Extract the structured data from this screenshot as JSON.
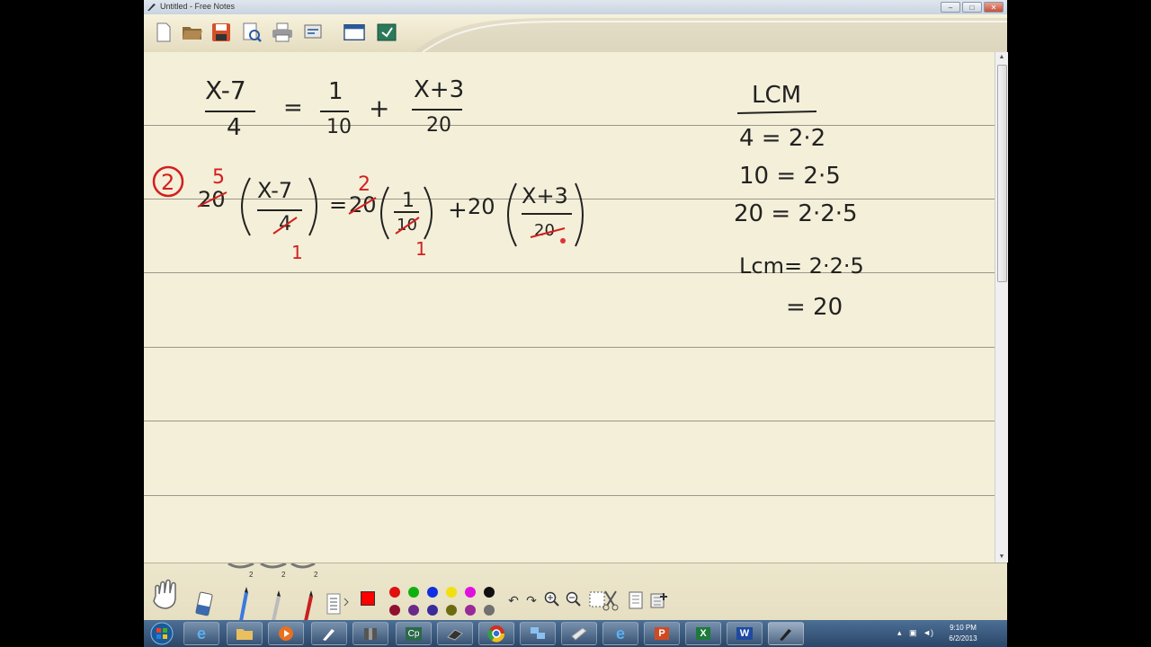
{
  "window": {
    "title": "Untitled - Free Notes"
  },
  "titlebar_buttons": {
    "minimize": "–",
    "maximize": "□",
    "close": "✕"
  },
  "toolbar": {
    "icons": [
      "new-file-icon",
      "open-folder-icon",
      "save-icon",
      "print-preview-icon",
      "print-icon",
      "settings-icon",
      "window-icon",
      "export-icon"
    ]
  },
  "notes": {
    "ink_color": "#222222",
    "correction_color": "#d21f1f",
    "equation": {
      "lhs_num": "X-7",
      "lhs_den": "4",
      "eq": "=",
      "t1_num": "1",
      "t1_den": "10",
      "plus": "+",
      "t2_num": "X+3",
      "t2_den": "20"
    },
    "step2": {
      "circle": "2",
      "mult1": "20",
      "r1": "5",
      "f1_num": "X-7",
      "f1_den": "4",
      "f1_red": "1",
      "eq": "=",
      "mult2": "20",
      "r2": "2",
      "f2_num": "1",
      "f2_den": "10",
      "f2_red": "1",
      "plus": "+",
      "mult3": "20",
      "f3_num": "X+3",
      "f3_den": "20"
    },
    "lcm": {
      "heading": "LCM",
      "lines": [
        "4 = 2·2",
        "10 = 2·5",
        "20 = 2·2·5"
      ],
      "result_label": "Lcm= 2·2·5",
      "result_value": "= 20"
    }
  },
  "bottombar": {
    "pen_widths": [
      "2",
      "2",
      "2"
    ],
    "colors": [
      "#e01010",
      "#10b010",
      "#1030e0",
      "#f0e010",
      "#e010e0",
      "#101010",
      "#901030",
      "#6a2a8a",
      "#3a2a9a",
      "#6b6b10",
      "#9a2a9a",
      "#707070"
    ],
    "selected_color": "#ff0000"
  },
  "taskbar": {
    "apps": [
      "start-orb",
      "ie-icon",
      "explorer-icon",
      "media-player-icon",
      "free-notes-icon",
      "archive-icon",
      "captivate-icon",
      "camera-icon",
      "chrome-icon",
      "network-icon",
      "notepad-icon",
      "ie-icon-2",
      "powerpoint-icon",
      "excel-icon",
      "word-icon",
      "free-notes-icon-2"
    ],
    "time": "9:10 PM",
    "date": "6/2/2013"
  }
}
